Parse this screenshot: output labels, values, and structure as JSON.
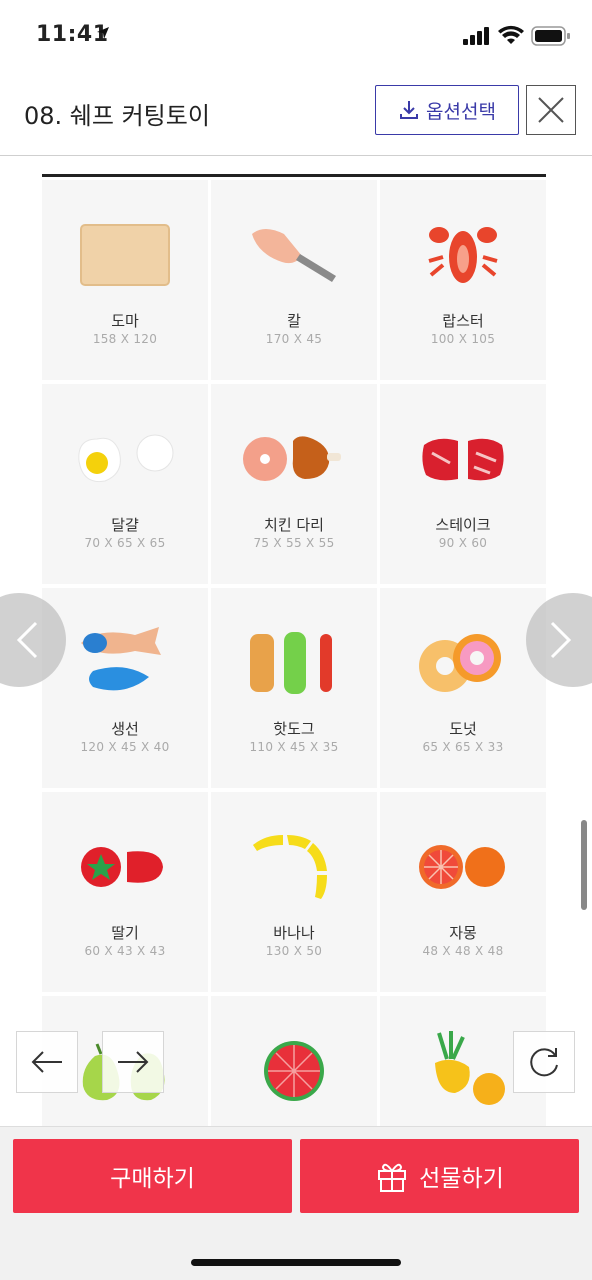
{
  "status": {
    "time": "11:41"
  },
  "header": {
    "title": "08. 쉐프 커팅토이",
    "option_button": "옵션선택"
  },
  "items": [
    {
      "name": "도마",
      "size": "158 X 120",
      "icon": "cutting-board"
    },
    {
      "name": "칼",
      "size": "170 X 45",
      "icon": "knife"
    },
    {
      "name": "랍스터",
      "size": "100 X 105",
      "icon": "lobster"
    },
    {
      "name": "달걀",
      "size": "70 X 65 X 65",
      "icon": "egg"
    },
    {
      "name": "치킨 다리",
      "size": "75 X 55 X 55",
      "icon": "chicken-leg"
    },
    {
      "name": "스테이크",
      "size": "90 X 60",
      "icon": "steak"
    },
    {
      "name": "생선",
      "size": "120 X 45 X 40",
      "icon": "fish"
    },
    {
      "name": "핫도그",
      "size": "110 X 45 X 35",
      "icon": "hotdog"
    },
    {
      "name": "도넛",
      "size": "65 X 65 X 33",
      "icon": "donut"
    },
    {
      "name": "딸기",
      "size": "60 X 43 X 43",
      "icon": "strawberry"
    },
    {
      "name": "바나나",
      "size": "130 X 50",
      "icon": "banana"
    },
    {
      "name": "자몽",
      "size": "48 X 48 X 48",
      "icon": "grapefruit"
    },
    {
      "name": "",
      "size": "",
      "icon": "pear"
    },
    {
      "name": "",
      "size": "",
      "icon": "watermelon"
    },
    {
      "name": "",
      "size": "",
      "icon": "onion"
    }
  ],
  "bottom": {
    "buy_label": "구매하기",
    "gift_label": "선물하기"
  },
  "colors": {
    "accent_red": "#f0344a",
    "option_blue": "#3a3aa8"
  }
}
